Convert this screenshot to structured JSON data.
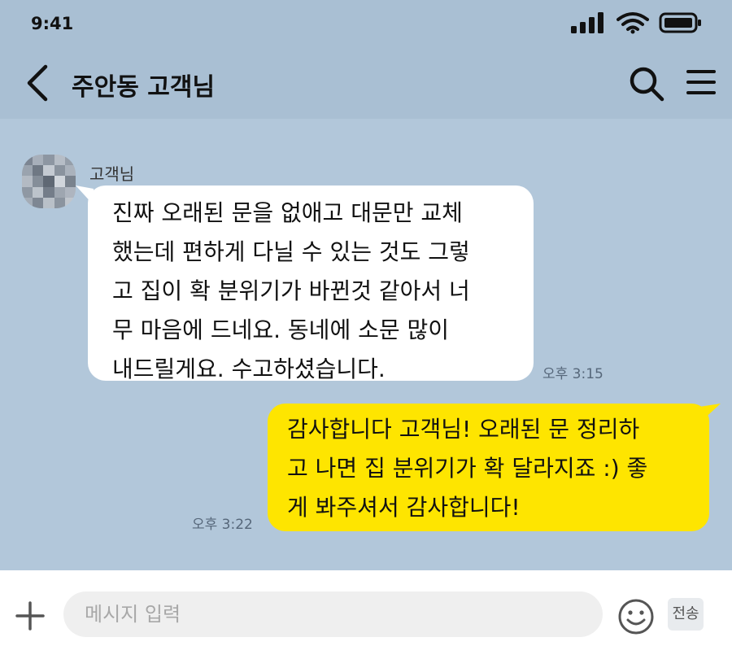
{
  "status_bar": {
    "time": "9:41"
  },
  "header": {
    "title": "주안동 고객님"
  },
  "chat": {
    "messages": [
      {
        "direction": "incoming",
        "sender": "고객님",
        "text": "진짜 오래된 문을 없애고 대문만 교체\n했는데 편하게 다닐 수 있는 것도 그렇\n고 집이 확 분위기가 바뀐것 같아서 너\n무 마음에 드네요. 동네에 소문 많이\n내드릴게요. 수고하셨습니다.",
        "time": "오후 3:15"
      },
      {
        "direction": "outgoing",
        "text": "감사합니다 고객님! 오래된 문 정리하\n고 나면 집 분위기가 확 달라지죠 :) 좋\n게 봐주셔서 감사합니다!",
        "time": "오후 3:22"
      }
    ]
  },
  "input_bar": {
    "placeholder": "메시지 입력",
    "send_label": "전송"
  },
  "colors": {
    "background": "#b2c7da",
    "header": "#a9bfd3",
    "incoming_bubble": "#ffffff",
    "outgoing_bubble": "#fee500"
  }
}
